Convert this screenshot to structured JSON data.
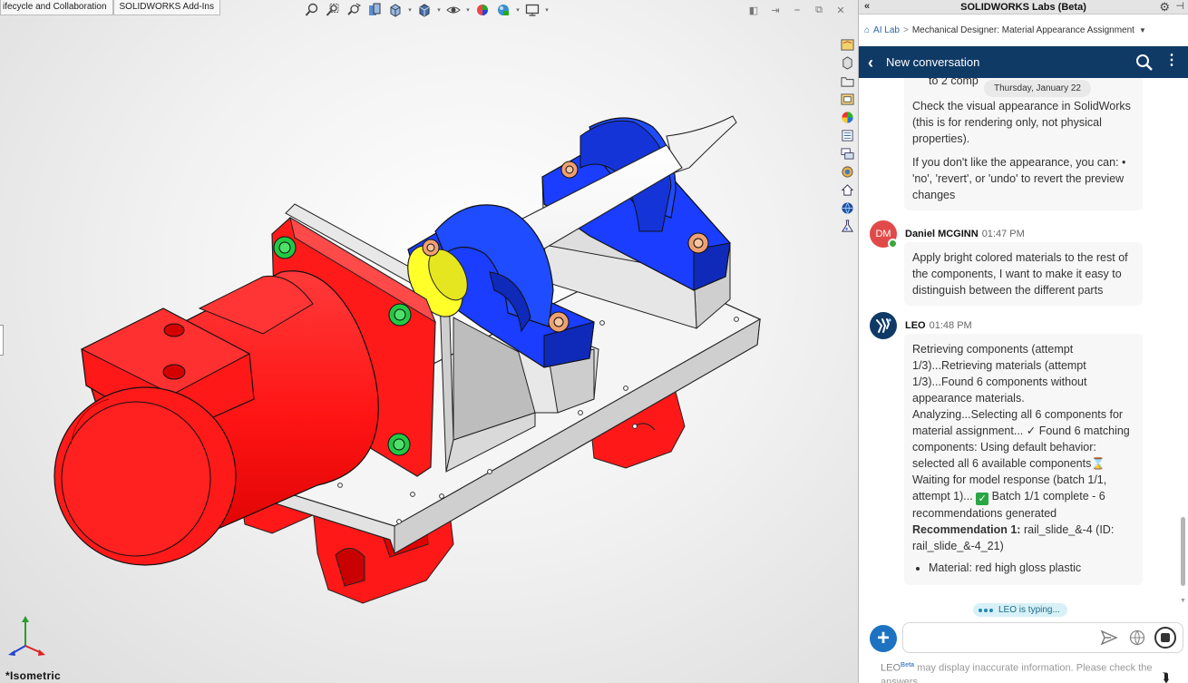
{
  "viewport": {
    "tabs": [
      "ifecycle and Collaboration",
      "SOLIDWORKS Add-Ins"
    ],
    "view_name": "*Isometric",
    "heads_up_icons": [
      "zoom-to-fit-icon",
      "zoom-area-icon",
      "previous-view-icon",
      "section-view-icon",
      "view-orientation-icon",
      "display-style-icon",
      "hide-show-icon",
      "edit-appearance-icon",
      "apply-scene-icon",
      "view-settings-icon"
    ],
    "task_pane_icons": [
      "solidworks-resources-icon",
      "design-library-icon",
      "file-explorer-icon",
      "view-palette-icon",
      "appearances-icon",
      "custom-properties-icon",
      "forum-icon",
      "3dexperience-icon",
      "home-icon",
      "globe-icon",
      "labs-icon"
    ],
    "colors": {
      "motor": "#ff1a1a",
      "pillow_blocks": "#1a4fff",
      "shaft": "#ffffff",
      "base_plate": "#f0f0f0",
      "coupling": "#ffff33",
      "bolt_green": "#22cc44",
      "bolt_copper": "#f0a070"
    }
  },
  "panel": {
    "title": "SOLIDWORKS Labs (Beta)",
    "breadcrumb": {
      "root": "AI Lab",
      "separator": ">",
      "current": "Mechanical Designer: Material Appearance Assignment"
    },
    "header": {
      "title": "New conversation"
    },
    "date_pill": "Thursday, January 22",
    "messages": [
      {
        "sender": "",
        "fragment": "to 2 comp",
        "paragraphs": [
          "Check the visual appearance in SolidWorks (this is for rendering only, not physical properties).",
          "If you don't like the appearance, you can: • 'no', 'revert', or 'undo' to revert the preview changes"
        ]
      },
      {
        "sender": "Daniel MCGINN",
        "initials": "DM",
        "time": "01:47 PM",
        "text": "Apply bright colored materials to the rest of the components, I want to make it easy to distinguish between the different parts"
      },
      {
        "sender": "LEO",
        "time": "01:48 PM",
        "line1": "Retrieving components (attempt 1/3)...Retrieving materials (attempt 1/3)...Found 6 components without appearance materials.",
        "line2a": "Analyzing...Selecting all 6 components for material assignment... ✓ Found 6 matching components: Using default behavior: selected all 6 available components",
        "line2b": "Waiting for model response (batch 1/1, attempt 1)...",
        "line2c": "Batch 1/1 complete - 6 recommendations generated",
        "rec_label": "Recommendation 1:",
        "rec_text": "rail_slide_&-4 (ID: rail_slide_&-4_21)",
        "bullet": "Material: red high gloss plastic"
      }
    ],
    "typing": "LEO is typing...",
    "input": {
      "value": "",
      "placeholder": ""
    },
    "disclaimer": {
      "name": "LEO",
      "badge": "Beta",
      "text": "may display inaccurate information. Please check the answers."
    }
  }
}
